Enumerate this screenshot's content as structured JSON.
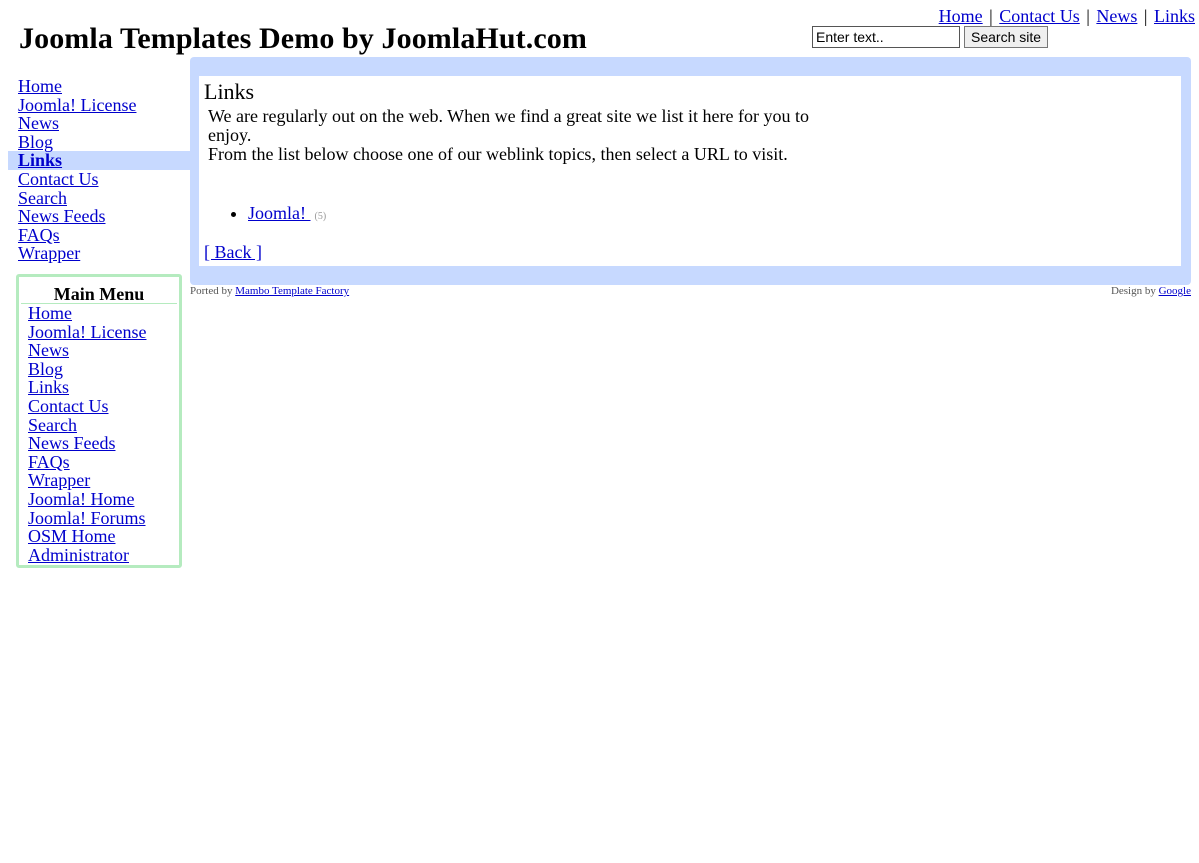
{
  "header": {
    "site_title": "Joomla Templates Demo by JoomlaHut.com",
    "top_nav": [
      {
        "label": "Home"
      },
      {
        "label": "Contact Us"
      },
      {
        "label": "News"
      },
      {
        "label": "Links"
      }
    ],
    "separator": "|",
    "search": {
      "value": "Enter text..",
      "button_label": "Search site"
    }
  },
  "left_nav": {
    "items": [
      {
        "label": "Home"
      },
      {
        "label": "Joomla! License"
      },
      {
        "label": "News"
      },
      {
        "label": "Blog"
      },
      {
        "label": "Links",
        "active": true
      },
      {
        "label": "Contact Us"
      },
      {
        "label": "Search"
      },
      {
        "label": "News Feeds"
      },
      {
        "label": "FAQs"
      },
      {
        "label": "Wrapper"
      }
    ]
  },
  "main_menu": {
    "title": "Main Menu",
    "items": [
      {
        "label": "Home"
      },
      {
        "label": "Joomla! License"
      },
      {
        "label": "News"
      },
      {
        "label": "Blog"
      },
      {
        "label": "Links"
      },
      {
        "label": "Contact Us"
      },
      {
        "label": "Search"
      },
      {
        "label": "News Feeds"
      },
      {
        "label": "FAQs"
      },
      {
        "label": "Wrapper"
      },
      {
        "label": "Joomla! Home"
      },
      {
        "label": "Joomla! Forums"
      },
      {
        "label": "OSM Home"
      },
      {
        "label": "Administrator"
      }
    ]
  },
  "content": {
    "heading": "Links",
    "intro_line1": "We are regularly out on the web. When we find a great site we list it here for you to enjoy.",
    "intro_line2": "From the list below choose one of our weblink topics, then select a URL to visit.",
    "categories": [
      {
        "label": "Joomla! ",
        "count": "(5)"
      }
    ],
    "back_label": "[ Back ]"
  },
  "footer": {
    "ported_prefix": "Ported by",
    "ported_link": "Mambo Template Factory",
    "design_prefix": "Design by",
    "design_link": "Google"
  },
  "colors": {
    "link": "#0000cc",
    "panel_bg": "#c7d9ff",
    "menu_border": "#b5ebbf",
    "footer_text": "#555555"
  }
}
